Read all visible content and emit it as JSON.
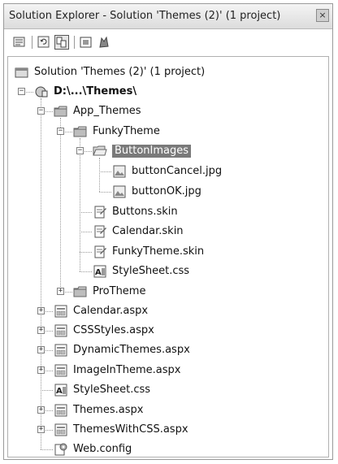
{
  "window": {
    "title": "Solution Explorer - Solution 'Themes (2)' (1 project)",
    "close_glyph": "×"
  },
  "toolbar": {
    "buttons": [
      "properties-icon",
      "refresh-icon",
      "show-all-files-icon",
      "view-code-icon",
      "view-designer-icon"
    ]
  },
  "tree": [
    {
      "label": "Solution 'Themes (2)' (1 project)",
      "icon": "solution-icon"
    },
    {
      "label": "D:\\...\\Themes\\",
      "icon": "web-project-icon",
      "bold": true,
      "expander": "−"
    },
    {
      "label": "App_Themes",
      "icon": "folder-icon",
      "expander": "−"
    },
    {
      "label": "FunkyTheme",
      "icon": "folder-icon",
      "expander": "−"
    },
    {
      "label": "ButtonImages",
      "icon": "folder-open-icon",
      "expander": "−",
      "selected": true
    },
    {
      "label": "buttonCancel.jpg",
      "icon": "image-file-icon"
    },
    {
      "label": "buttonOK.jpg",
      "icon": "image-file-icon"
    },
    {
      "label": "Buttons.skin",
      "icon": "skin-file-icon"
    },
    {
      "label": "Calendar.skin",
      "icon": "skin-file-icon"
    },
    {
      "label": "FunkyTheme.skin",
      "icon": "skin-file-icon"
    },
    {
      "label": "StyleSheet.css",
      "icon": "css-file-icon"
    },
    {
      "label": "ProTheme",
      "icon": "folder-icon",
      "expander": "+"
    },
    {
      "label": "Calendar.aspx",
      "icon": "aspx-file-icon",
      "expander": "+"
    },
    {
      "label": "CSSStyles.aspx",
      "icon": "aspx-file-icon",
      "expander": "+"
    },
    {
      "label": "DynamicThemes.aspx",
      "icon": "aspx-file-icon",
      "expander": "+"
    },
    {
      "label": "ImageInTheme.aspx",
      "icon": "aspx-file-icon",
      "expander": "+"
    },
    {
      "label": "StyleSheet.css",
      "icon": "css-file-icon"
    },
    {
      "label": "Themes.aspx",
      "icon": "aspx-file-icon",
      "expander": "+"
    },
    {
      "label": "ThemesWithCSS.aspx",
      "icon": "aspx-file-icon",
      "expander": "+"
    },
    {
      "label": "Web.config",
      "icon": "config-file-icon"
    }
  ]
}
